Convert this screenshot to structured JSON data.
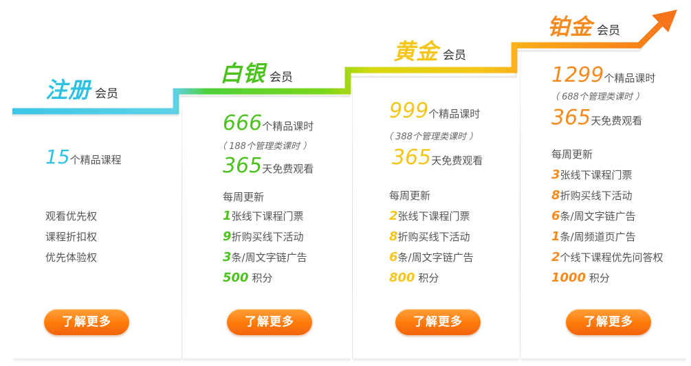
{
  "colors": {
    "register": "#2ec1e3",
    "silver": "#4cc21e",
    "gold": "#f6c51a",
    "platinum": "#f68a1e",
    "button": "#ff7a0a"
  },
  "tiers": [
    {
      "title": "注册",
      "suffix": "会员",
      "courses_num": "15",
      "courses_text": "个精品课程",
      "perks": [
        "观看优先权",
        "课程折扣权",
        "优先体验权"
      ],
      "button": "了解更多"
    },
    {
      "title": "白银",
      "suffix": "会员",
      "courses_num": "666",
      "courses_text": "个精品课时",
      "mgmt": "（ 188个管理类课时 ）",
      "days_num": "365",
      "days_text": "天免费观看",
      "weekly": "每周更新",
      "benefits": [
        {
          "num": "1",
          "text": "张线下课程门票"
        },
        {
          "num": "9",
          "text": "折购买线下活动"
        },
        {
          "num": "3",
          "text": "条/周文字链广告"
        }
      ],
      "points_num": "500",
      "points_text": "积分",
      "button": "了解更多"
    },
    {
      "title": "黄金",
      "suffix": "会员",
      "courses_num": "999",
      "courses_text": "个精品课时",
      "mgmt": "（ 388个管理类课时 ）",
      "days_num": "365",
      "days_text": "天免费观看",
      "weekly": "每周更新",
      "benefits": [
        {
          "num": "2",
          "text": "张线下课程门票"
        },
        {
          "num": "8",
          "text": "折购买线下活动"
        },
        {
          "num": "6",
          "text": "条/周文字链广告"
        }
      ],
      "points_num": "800",
      "points_text": "积分",
      "button": "了解更多"
    },
    {
      "title": "铂金",
      "suffix": "会员",
      "courses_num": "1299",
      "courses_text": "个精品课时",
      "mgmt": "（ 688个管理类课时 ）",
      "days_num": "365",
      "days_text": "天免费观看",
      "weekly": "每周更新",
      "benefits": [
        {
          "num": "3",
          "text": "张线下课程门票"
        },
        {
          "num": "8",
          "text": "折购买线下活动"
        },
        {
          "num": "6",
          "text": "条/周文字链广告"
        },
        {
          "num": "1",
          "text": "条/周频道页广告"
        },
        {
          "num": "2",
          "text": "个线下课程优先问答权"
        }
      ],
      "points_num": "1000",
      "points_text": "积分",
      "button": "了解更多"
    }
  ]
}
